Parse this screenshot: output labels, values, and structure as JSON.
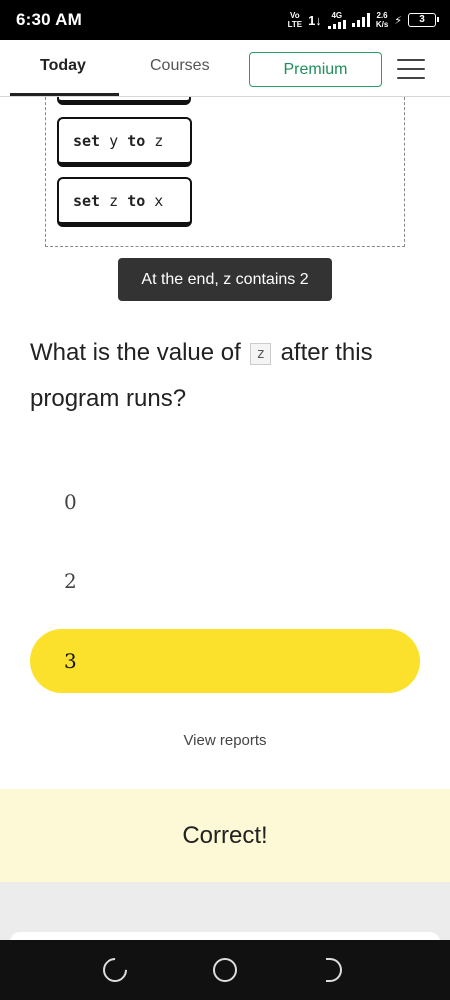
{
  "status_bar": {
    "time": "6:30 AM",
    "carrier_top": "Vo",
    "carrier_bottom": "LTE",
    "network": "4G",
    "speed_value": "2.6",
    "speed_unit": "K/s",
    "battery": "3"
  },
  "nav": {
    "tabs": [
      {
        "label": "Today",
        "active": true
      },
      {
        "label": "Courses",
        "active": false
      }
    ],
    "premium_label": "Premium",
    "accent_color": "#2a9d6a"
  },
  "code": {
    "blocks": [
      {
        "kw1": "set",
        "var1": "y",
        "kw2": "to",
        "var2": "z"
      },
      {
        "kw1": "set",
        "var1": "z",
        "kw2": "to",
        "var2": "x"
      }
    ]
  },
  "tooltip": "At the end, z contains 2",
  "question": {
    "before": "What is the value of",
    "variable": "z",
    "after": "after this program runs?"
  },
  "answers": [
    {
      "label": "0",
      "selected": false
    },
    {
      "label": "2",
      "selected": false
    },
    {
      "label": "3",
      "selected": true
    }
  ],
  "selected_color": "#fbe12b",
  "view_reports": "View reports",
  "feedback": "Correct!",
  "feedback_color": "#fdf8d5",
  "system_nav": [
    "recent-apps-icon",
    "home-icon",
    "back-icon"
  ]
}
